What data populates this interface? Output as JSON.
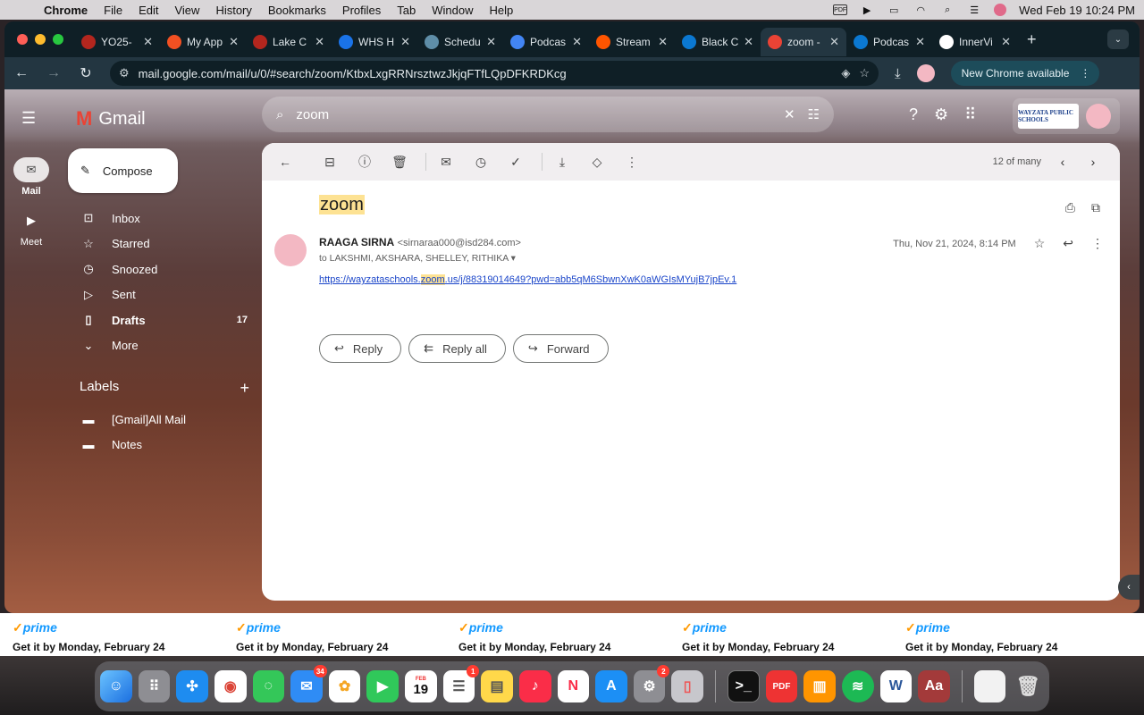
{
  "menubar": {
    "app": "Chrome",
    "items": [
      "File",
      "Edit",
      "View",
      "History",
      "Bookmarks",
      "Profiles",
      "Tab",
      "Window",
      "Help"
    ],
    "status_pdf": "PDF",
    "datetime": "Wed Feb 19  10:24 PM"
  },
  "tabs": [
    {
      "label": "YO25-",
      "color": "#b3261e"
    },
    {
      "label": "My App",
      "color": "#f25022"
    },
    {
      "label": "Lake C",
      "color": "#b3261e"
    },
    {
      "label": "WHS H",
      "color": "#1a73e8"
    },
    {
      "label": "Schedu",
      "color": "#5f8ea8"
    },
    {
      "label": "Podcas",
      "color": "#4285f4"
    },
    {
      "label": "Stream",
      "color": "#ff5500"
    },
    {
      "label": "Black C",
      "color": "#0b78d1"
    },
    {
      "label": "zoom -",
      "color": "#ea4335",
      "active": true
    },
    {
      "label": "Podcas",
      "color": "#0b78d1"
    },
    {
      "label": "InnerVi",
      "color": "#ffffff"
    }
  ],
  "toolbar": {
    "url": "mail.google.com/mail/u/0/#search/zoom/KtbxLxgRRNrsztwzJkjqFTfLQpDFKRDKcg",
    "update_label": "New Chrome available"
  },
  "gmail": {
    "logo_text": "Gmail",
    "rail": {
      "mail": "Mail",
      "meet": "Meet"
    },
    "search_value": "zoom",
    "compose_label": "Compose",
    "nav": [
      {
        "label": "Inbox",
        "icon": "inbox-icon",
        "glyph": "⊡"
      },
      {
        "label": "Starred",
        "icon": "star-icon",
        "glyph": "☆"
      },
      {
        "label": "Snoozed",
        "icon": "clock-icon",
        "glyph": "◷"
      },
      {
        "label": "Sent",
        "icon": "send-icon",
        "glyph": "▷"
      },
      {
        "label": "Drafts",
        "icon": "draft-icon",
        "glyph": "▯",
        "count": "17",
        "bold": true
      },
      {
        "label": "More",
        "icon": "chevron-down-icon",
        "glyph": "⌄"
      }
    ],
    "labels_heading": "Labels",
    "labels": [
      {
        "label": "[Gmail]All Mail"
      },
      {
        "label": "Notes"
      }
    ],
    "account_logo_text": "WAYZATA PUBLIC SCHOOLS"
  },
  "message": {
    "pager": "12 of many",
    "subject": "zoom",
    "sender_name": "RAAGA SIRNA",
    "sender_email": "<sirnaraa000@isd284.com>",
    "recipients": "to LAKSHMI, AKSHARA, SHELLEY, RITHIKA",
    "date": "Thu, Nov 21, 2024, 8:14 PM",
    "link_pre": "https://wayzataschools.",
    "link_hl": "zoom",
    "link_post": ".us/j/88319014649?pwd=abb5qM6SbwnXwK0aWGIsMYujB7jpEv.1",
    "actions": {
      "reply": "Reply",
      "reply_all": "Reply all",
      "forward": "Forward"
    }
  },
  "behind_page": {
    "prime": "prime",
    "delivery": "Get it by Monday, February 24"
  },
  "dock": {
    "messages_badge": "34",
    "reminders_badge": "1",
    "settings_badge": "2",
    "calendar_month": "FEB",
    "calendar_day": "19"
  }
}
